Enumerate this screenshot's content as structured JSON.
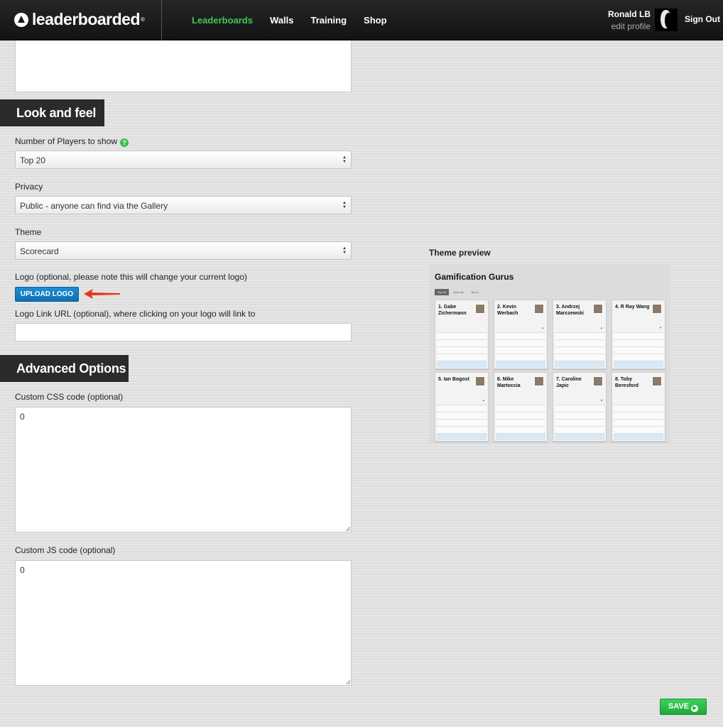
{
  "header": {
    "logo_text": "leaderboarded",
    "logo_reg": "®",
    "nav": [
      {
        "label": "Leaderboards"
      },
      {
        "label": "Walls"
      },
      {
        "label": "Training"
      },
      {
        "label": "Shop"
      }
    ],
    "user_name": "Ronald LB",
    "edit_profile": "edit profile",
    "sign_out": "Sign Out"
  },
  "look_and_feel": {
    "title": "Look and feel",
    "players_label": "Number of Players to show",
    "players_value": "Top 20",
    "privacy_label": "Privacy",
    "privacy_value": "Public - anyone can find via the Gallery",
    "theme_label": "Theme",
    "theme_value": "Scorecard",
    "logo_label": "Logo (optional, please note this will change your current logo)",
    "upload_label": "UPLOAD LOGO",
    "logo_link_label": "Logo Link URL (optional), where clicking on your logo will link to",
    "logo_link_value": ""
  },
  "advanced": {
    "title": "Advanced Options",
    "css_label": "Custom CSS code (optional)",
    "css_value": "0",
    "js_label": "Custom JS code (optional)",
    "js_value": "0"
  },
  "preview": {
    "heading": "Theme preview",
    "title": "Gamification Gurus",
    "tabs": [
      "Top 20",
      "Near Me",
      "About"
    ],
    "cards": [
      {
        "name": "1. Gabe Zichermann"
      },
      {
        "name": "2. Kevin Werbach"
      },
      {
        "name": "3. Andrzej Marczewski"
      },
      {
        "name": "4. R Ray Wang"
      },
      {
        "name": "5. Ian Bogost"
      },
      {
        "name": "6. Mike Martoccia"
      },
      {
        "name": "7. Caroline Japic"
      },
      {
        "name": "8. Toby Beresford"
      }
    ]
  },
  "save_label": "SAVE",
  "colors": {
    "nav_active": "#3ec95a",
    "upload_button": "#1580c6",
    "save_button": "#2dbd48",
    "arrow": "#e8351f"
  }
}
